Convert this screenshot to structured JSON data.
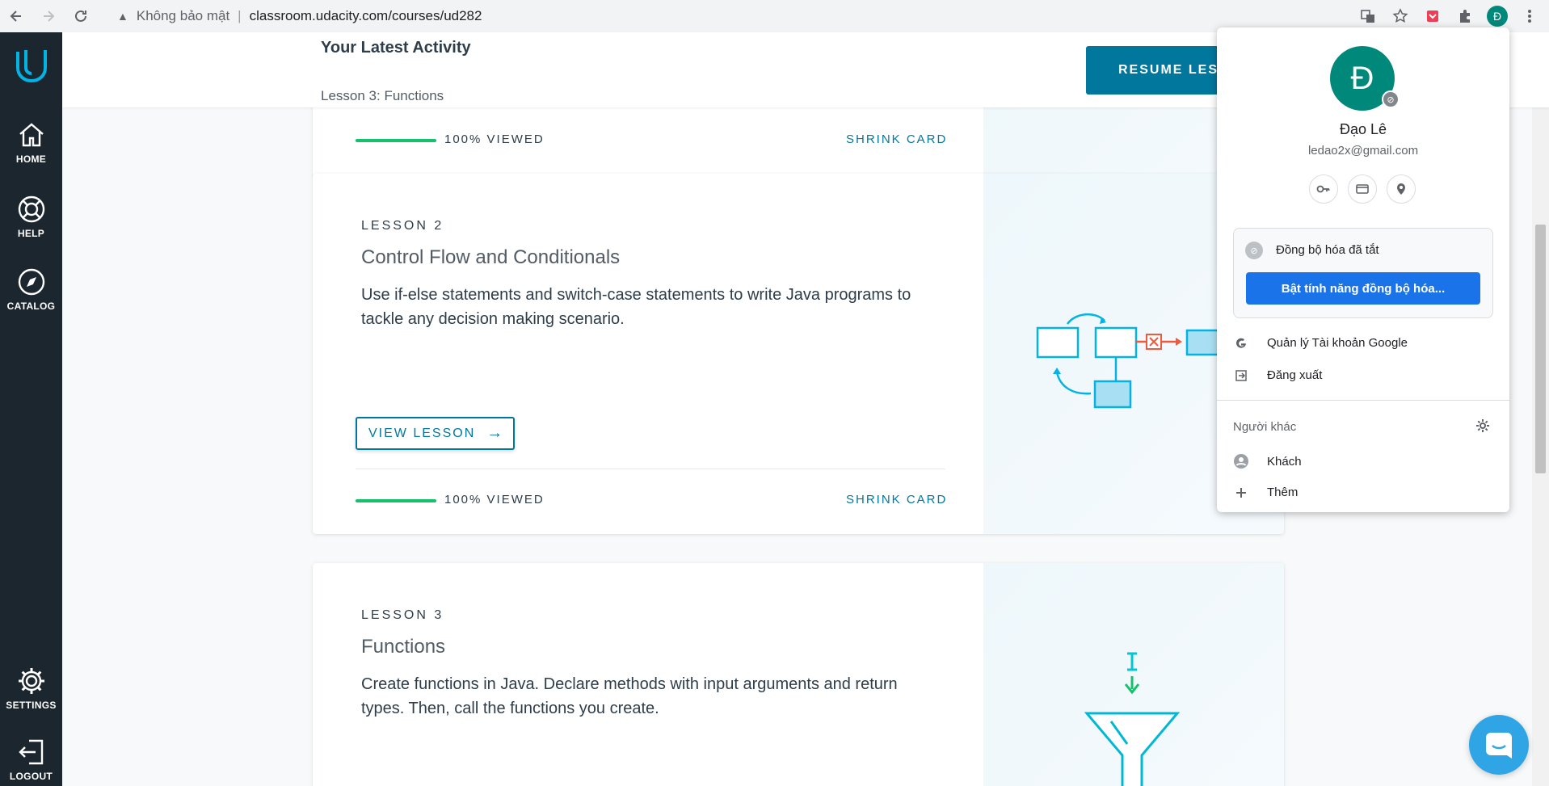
{
  "browser": {
    "security_label": "Không bảo mật",
    "url": "classroom.udacity.com/courses/ud282",
    "profile_initial": "Đ"
  },
  "sidebar": {
    "items": [
      {
        "label": "HOME",
        "icon": "home-icon"
      },
      {
        "label": "HELP",
        "icon": "lifebuoy-icon"
      },
      {
        "label": "CATALOG",
        "icon": "compass-icon"
      },
      {
        "label": "SETTINGS",
        "icon": "gear-icon"
      },
      {
        "label": "LOGOUT",
        "icon": "logout-icon"
      }
    ]
  },
  "header": {
    "title": "Your Latest Activity",
    "subtitle": "Lesson 3: Functions",
    "resume_label": "RESUME LESSON"
  },
  "lessons": [
    {
      "viewed": "100% VIEWED",
      "shrink": "SHRINK CARD",
      "progress": 1.0
    },
    {
      "number": "LESSON 2",
      "title": "Control Flow and Conditionals",
      "description": "Use if-else statements and switch-case statements to write Java programs to tackle any decision making scenario.",
      "view_label": "VIEW LESSON",
      "viewed": "100% VIEWED",
      "shrink": "SHRINK CARD",
      "progress": 1.0
    },
    {
      "number": "LESSON 3",
      "title": "Functions",
      "description": "Create functions in Java. Declare methods with input arguments and return types. Then, call the functions you create."
    }
  ],
  "profile_menu": {
    "avatar_initial": "Đ",
    "name": "Đạo Lê",
    "email": "ledao2x@gmail.com",
    "sync_status": "Đồng bộ hóa đã tắt",
    "sync_button": "Bật tính năng đồng bộ hóa...",
    "manage_account": "Quản lý Tài khoản Google",
    "sign_out": "Đăng xuất",
    "others_label": "Người khác",
    "guest": "Khách",
    "add": "Thêm"
  },
  "colors": {
    "sidebar_bg": "#1c262f",
    "accent": "#02779e",
    "progress": "#15c26b",
    "avatar": "#00897b",
    "chrome_blue": "#1a73e8"
  }
}
